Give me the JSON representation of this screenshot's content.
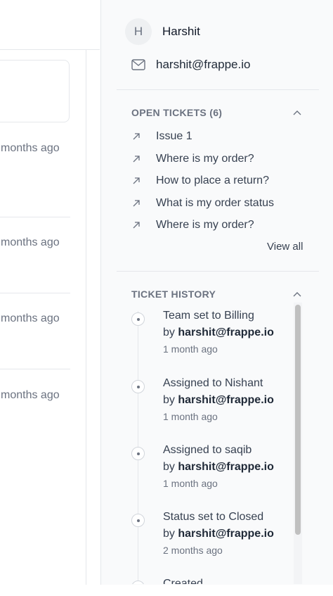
{
  "main": {
    "relative_times": [
      "months ago",
      "months ago",
      "months ago",
      "months ago"
    ]
  },
  "contact": {
    "avatar_initial": "H",
    "name": "Harshit",
    "email": "harshit@frappe.io"
  },
  "open_tickets": {
    "title": "OPEN TICKETS (6)",
    "items": [
      {
        "label": "Issue 1"
      },
      {
        "label": "Where is my order?"
      },
      {
        "label": "How to place a return?"
      },
      {
        "label": "What is my order status"
      },
      {
        "label": "Where is my order?"
      }
    ],
    "view_all": "View all"
  },
  "ticket_history": {
    "title": "TICKET HISTORY",
    "events": [
      {
        "title": "Team set to Billing",
        "by_prefix": "by",
        "by": "harshit@frappe.io",
        "time": "1 month ago"
      },
      {
        "title": "Assigned to Nishant",
        "by_prefix": "by",
        "by": "harshit@frappe.io",
        "time": "1 month ago"
      },
      {
        "title": "Assigned to saqib",
        "by_prefix": "by",
        "by": "harshit@frappe.io",
        "time": "1 month ago"
      },
      {
        "title": "Status set to Closed",
        "by_prefix": "by",
        "by": "harshit@frappe.io",
        "time": "2 months ago"
      },
      {
        "title": "Created",
        "by_prefix": "",
        "by": "",
        "time": ""
      }
    ]
  },
  "icons": {
    "mail": "mail-icon",
    "ticket_link": "arrow-up-right-icon",
    "collapse": "chevron-up-icon",
    "timeline": "timeline-dot-icon"
  }
}
